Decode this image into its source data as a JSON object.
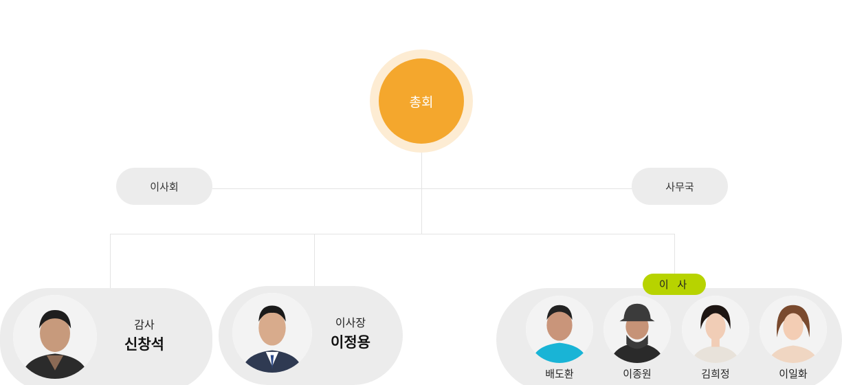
{
  "top_node": {
    "label": "총회",
    "color": "#f4a72d"
  },
  "board": {
    "label": "이사회"
  },
  "secretariat": {
    "label": "사무국"
  },
  "auditor": {
    "title": "감사",
    "name": "신창석"
  },
  "chairman": {
    "title": "이사장",
    "name": "이정용"
  },
  "directors": {
    "badge": "이 사",
    "badge_color": "#b7d300",
    "members": [
      {
        "name": "배도환"
      },
      {
        "name": "이종원"
      },
      {
        "name": "김희정"
      },
      {
        "name": "이일화"
      }
    ]
  }
}
